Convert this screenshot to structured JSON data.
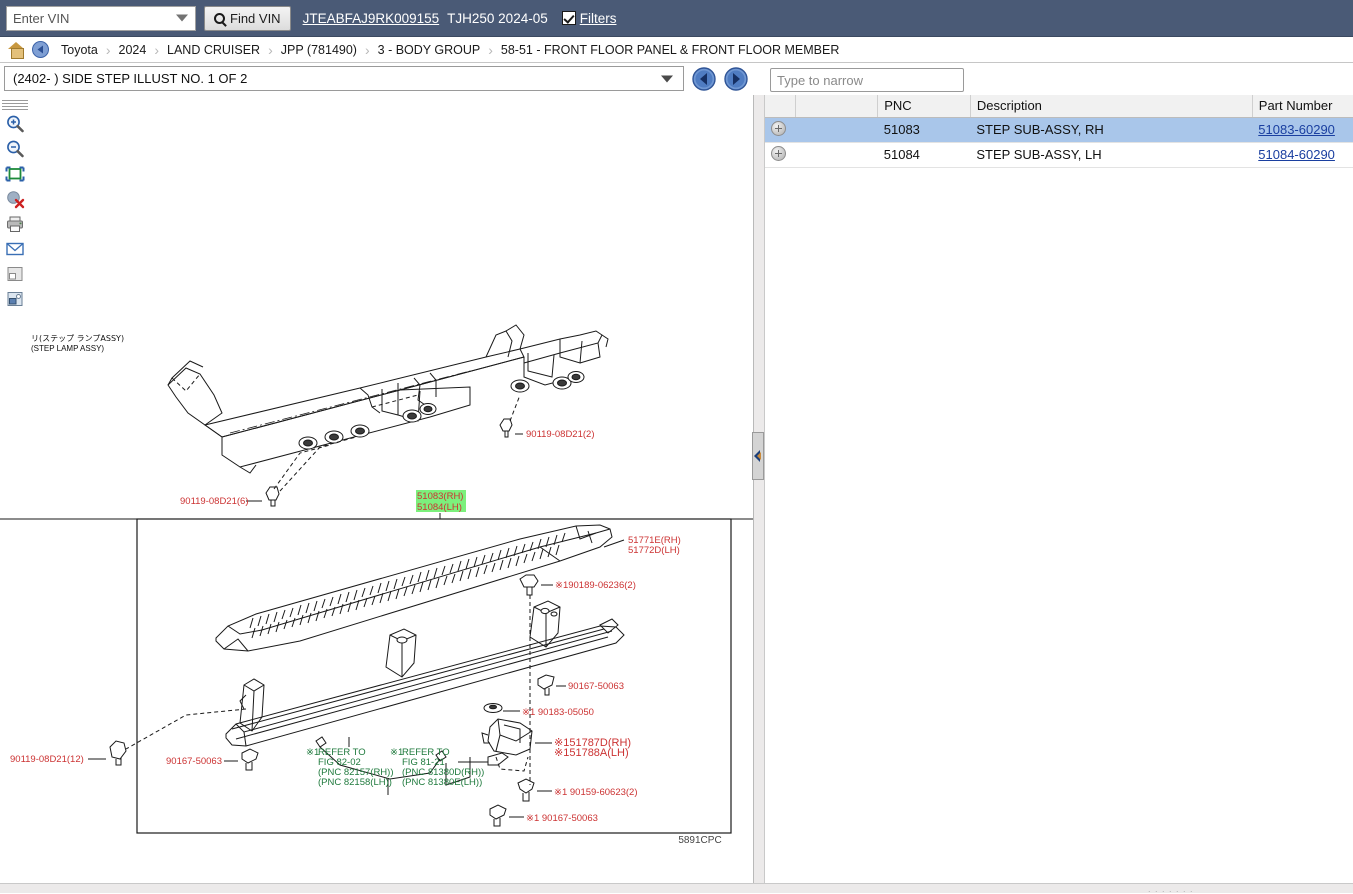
{
  "vin_bar": {
    "vin_select_value": "Enter VIN",
    "find_vin_label": "Find VIN",
    "vin_number": "JTEABFAJ9RK009155",
    "model_code": "TJH250 2024-05",
    "filters_label": "Filters",
    "search_icon": "search-icon",
    "dropdown_icon": "chevron-down-icon",
    "checkbox_checked": "checked"
  },
  "breadcrumb": {
    "home_icon": "home-icon",
    "back_icon": "back-arrow-icon",
    "items": [
      {
        "label": "Toyota"
      },
      {
        "label": "2024"
      },
      {
        "label": "LAND CRUISER"
      },
      {
        "label": "JPP (781490)"
      },
      {
        "label": "3 - BODY GROUP"
      },
      {
        "label": "58-51 - FRONT FLOOR PANEL & FRONT FLOOR MEMBER"
      }
    ],
    "separator": "›"
  },
  "illust_row": {
    "selected_illustration": "(2402- ) SIDE STEP ILLUST NO. 1 OF 2",
    "dropdown_icon": "chevron-down-icon",
    "prev_icon": "arrow-left-circle-icon",
    "next_icon": "arrow-right-circle-icon"
  },
  "viewer_toolbar": {
    "items": [
      {
        "icon": "drag-grip-icon",
        "name": "toolbar-drag-grip"
      },
      {
        "icon": "zoom-in-icon",
        "name": "zoom-in-button"
      },
      {
        "icon": "zoom-out-icon",
        "name": "zoom-out-button"
      },
      {
        "icon": "fit-to-window-icon",
        "name": "fit-to-window-button"
      },
      {
        "icon": "clear-highlight-icon",
        "name": "clear-highlight-button"
      },
      {
        "icon": "print-icon",
        "name": "print-button"
      },
      {
        "icon": "email-icon",
        "name": "email-button"
      },
      {
        "icon": "image-small-icon",
        "name": "thumbnail-button"
      },
      {
        "icon": "image-swap-icon",
        "name": "alternate-image-button"
      }
    ]
  },
  "splitter": {
    "icon": "collapse-left-icon"
  },
  "right_panel": {
    "search": {
      "placeholder": "Type to narrow",
      "value": ""
    },
    "columns": [
      "",
      "",
      "PNC",
      "Description",
      "Part Number"
    ],
    "rows": [
      {
        "expand_icon": "expand-plus-icon",
        "pnc": "51083",
        "description": "STEP SUB-ASSY, RH",
        "part_number": "51083-60290",
        "selected": true
      },
      {
        "expand_icon": "expand-plus-icon",
        "pnc": "51084",
        "description": "STEP SUB-ASSY, LH",
        "part_number": "51084-60290",
        "selected": false
      }
    ]
  },
  "diagram": {
    "figure_code": "5891CPC",
    "note_jp": "リ(ステップ ランプASSY)",
    "note_en": "(STEP LAMP ASSY)",
    "callouts": [
      {
        "text": "90119-08D21(2)",
        "color": "red"
      },
      {
        "text": "90119-08D21(6)",
        "color": "red"
      },
      {
        "text": "90119-08D21(12)",
        "color": "red"
      },
      {
        "text": "51083(RH)",
        "color": "red",
        "highlight": "#7cf07c"
      },
      {
        "text": "51084(LH)",
        "color": "red",
        "highlight": "#7cf07c"
      },
      {
        "text": "51771E(RH)",
        "color": "red"
      },
      {
        "text": "51772D(LH)",
        "color": "red"
      },
      {
        "text": "※190189-06236(2)",
        "color": "red"
      },
      {
        "text": "90167-50063",
        "color": "red"
      },
      {
        "text": "※1 90183-05050",
        "color": "red"
      },
      {
        "text": "※151787D(RH)",
        "color": "red"
      },
      {
        "text": "※151788A(LH)",
        "color": "red"
      },
      {
        "text": "※1 90159-60623(2)",
        "color": "red"
      },
      {
        "text": "※1 90167-50063",
        "color": "red"
      },
      {
        "text": "90167-50063",
        "color": "red"
      }
    ],
    "refer_blocks": [
      {
        "marker": "※1",
        "lines": [
          "REFER TO",
          "FIG 82-02",
          "(PNC 82157(RH))",
          "(PNC 82158(LH))"
        ],
        "color": "green"
      },
      {
        "marker": "※1",
        "lines": [
          "REFER TO",
          "FIG 81-21",
          "(PNC 81380D(RH))",
          "(PNC 81380E(LH))"
        ],
        "color": "green"
      }
    ]
  },
  "colors": {
    "vin_bar_bg": "#4a5a76",
    "selected_row": "#a9c6ea",
    "link": "#1a3fa0",
    "callout_red": "#cc3333",
    "callout_green": "#1f7a3d",
    "highlight_green": "#7cf07c"
  }
}
